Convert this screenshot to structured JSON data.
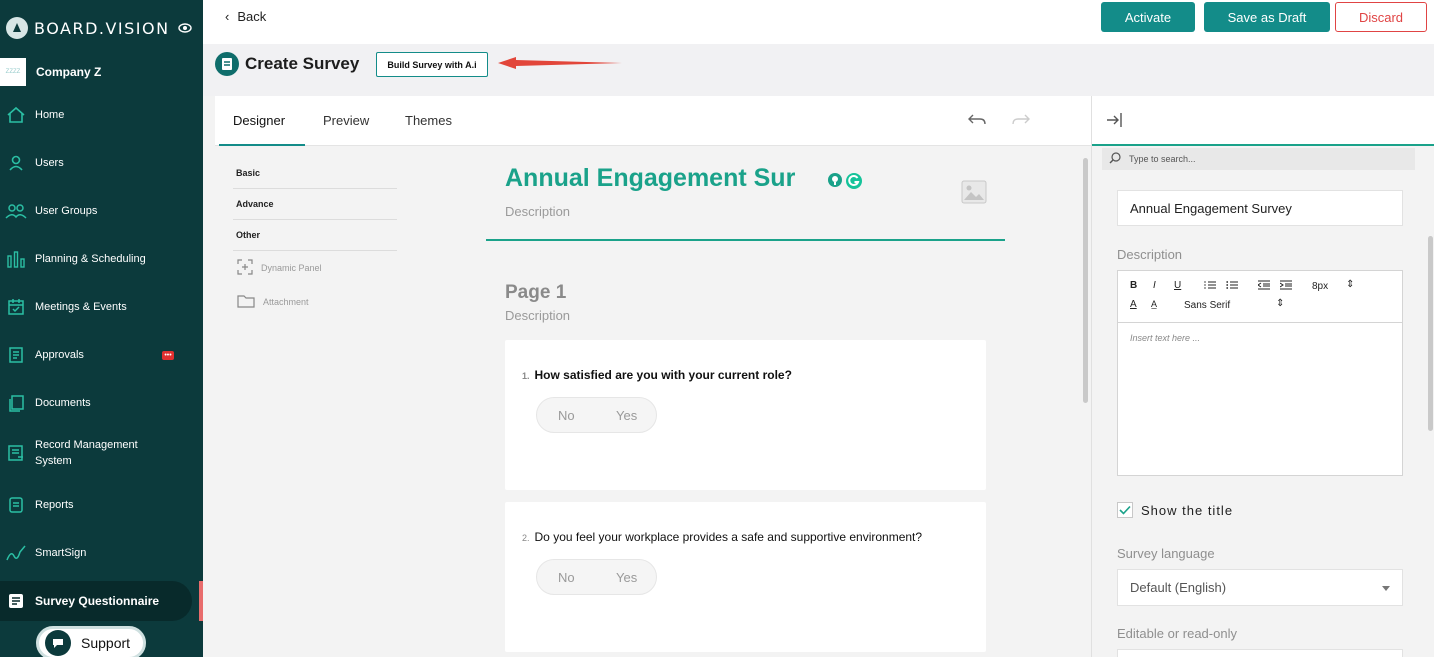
{
  "sidebar": {
    "brand": "BOARD.VISION",
    "company_badge": "ZZZZ",
    "company": "Company Z",
    "items": [
      {
        "label": "Home"
      },
      {
        "label": "Users"
      },
      {
        "label": "User Groups"
      },
      {
        "label": "Planning & Scheduling"
      },
      {
        "label": "Meetings & Events"
      },
      {
        "label": "Approvals"
      },
      {
        "label": "Documents"
      },
      {
        "label": "Record Management System"
      },
      {
        "label": "Reports"
      },
      {
        "label": "SmartSign"
      },
      {
        "label": "Survey Questionnaire"
      }
    ],
    "active_item": "Survey Questionnaire",
    "approvals_badge": "•••",
    "support": "Support"
  },
  "topbar": {
    "back": "Back",
    "activate": "Activate",
    "save_draft": "Save as Draft",
    "discard": "Discard"
  },
  "header": {
    "title": "Create Survey",
    "ai_button": "Build Survey with A.i"
  },
  "designer": {
    "tabs": [
      "Designer",
      "Preview",
      "Themes"
    ],
    "active_tab": "Designer",
    "toolbox": {
      "categories": [
        "Basic",
        "Advance",
        "Other"
      ],
      "items": [
        "Dynamic Panel",
        "Attachment"
      ]
    },
    "survey_title": "Annual Engagement Sur",
    "survey_description": "Description",
    "page_name": "Page 1",
    "page_description": "Description",
    "questions": [
      {
        "number": "1.",
        "text": "How satisfied are you with your current role?",
        "options": [
          "No",
          "Yes"
        ]
      },
      {
        "number": "2.",
        "text": "Do you feel your workplace provides a safe and supportive environment?",
        "options": [
          "No",
          "Yes"
        ]
      }
    ]
  },
  "properties": {
    "search_placeholder": "Type to search...",
    "title_value": "Annual Engagement Survey",
    "description_label": "Description",
    "editor": {
      "bold": "B",
      "italic": "I",
      "underline": "U",
      "font_size": "8px",
      "font_family": "Sans Serif",
      "placeholder": "Insert text here ..."
    },
    "show_title": "Show the title",
    "language_label": "Survey language",
    "language_value": "Default (English)",
    "editable_label": "Editable or read-only"
  },
  "colors": {
    "sidebar": "#0c3a3c",
    "accent": "#138c89",
    "title": "#1aa28a",
    "danger": "#e04444"
  }
}
